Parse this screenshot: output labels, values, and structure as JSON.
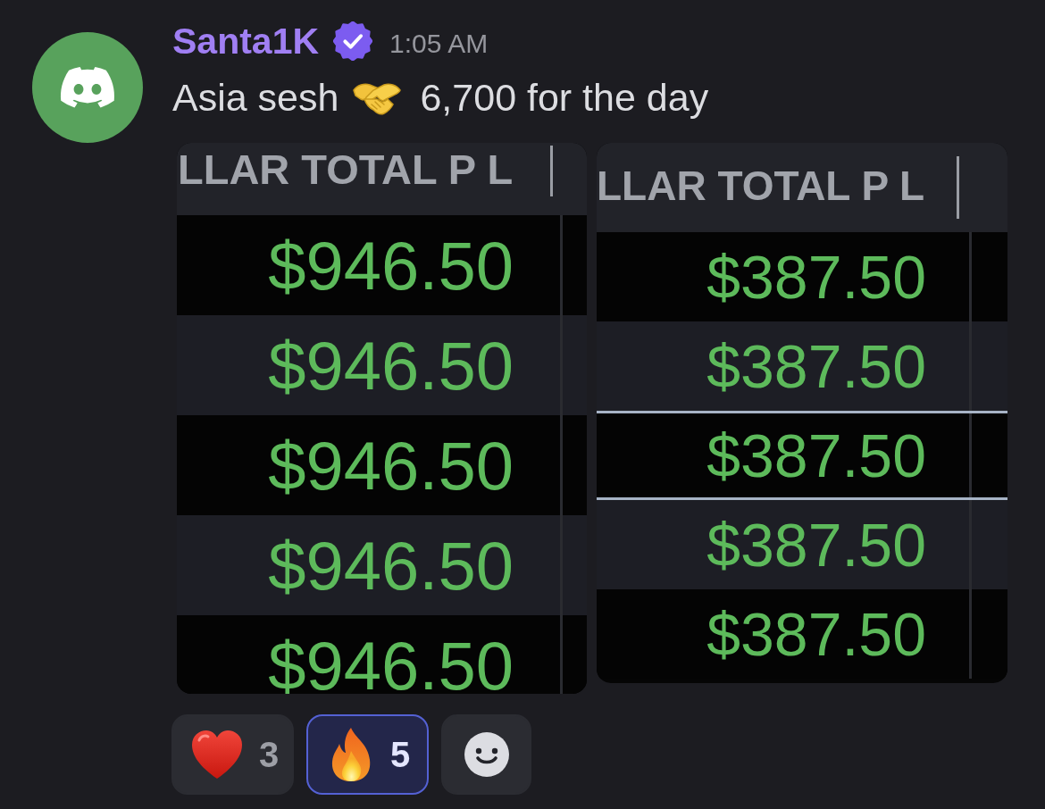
{
  "message": {
    "author": "Santa1K",
    "verified": true,
    "timestamp": "1:05 AM",
    "content": [
      {
        "kind": "text",
        "text": "Asia sesh"
      },
      {
        "kind": "emoji"
      },
      {
        "kind": "text",
        "text": "6,700 for the day"
      }
    ]
  },
  "attachments": [
    {
      "header": "LLAR TOTAL P L",
      "rows": [
        {
          "value": "$946.50",
          "selected": false
        },
        {
          "value": "$946.50",
          "selected": false
        },
        {
          "value": "$946.50",
          "selected": false
        },
        {
          "value": "$946.50",
          "selected": false
        },
        {
          "value": "$946.50",
          "selected": false
        }
      ]
    },
    {
      "header": "LLAR TOTAL P L",
      "rows": [
        {
          "value": "$387.50",
          "selected": false
        },
        {
          "value": "$387.50",
          "selected": false
        },
        {
          "value": "$387.50",
          "selected": true
        },
        {
          "value": "$387.50",
          "selected": false
        },
        {
          "value": "$387.50",
          "selected": false
        }
      ]
    }
  ],
  "reactions": [
    {
      "count": "3",
      "selected": false
    },
    {
      "count": "5",
      "selected": true
    }
  ]
}
